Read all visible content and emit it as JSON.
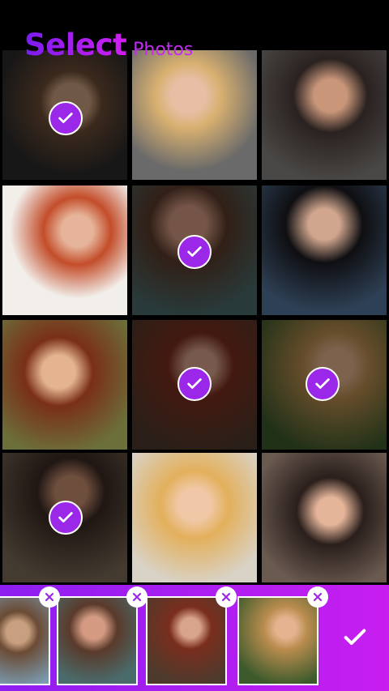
{
  "header": {
    "title_main": "Select",
    "title_sub": "Photos"
  },
  "grid": {
    "photos": [
      {
        "subject": "woman-sunglasses",
        "selected": true
      },
      {
        "subject": "blonde-woman-glasses",
        "selected": false
      },
      {
        "subject": "dark-hair-woman",
        "selected": false
      },
      {
        "subject": "redhead-sweater",
        "selected": false
      },
      {
        "subject": "smiling-woman-flowers",
        "selected": true
      },
      {
        "subject": "asian-woman-dark",
        "selected": false
      },
      {
        "subject": "curly-redhead",
        "selected": false
      },
      {
        "subject": "redhead-brick-wall",
        "selected": true
      },
      {
        "subject": "blonde-leaves",
        "selected": true
      },
      {
        "subject": "woman-empty-shirt",
        "selected": true
      },
      {
        "subject": "laughing-blonde",
        "selected": false
      },
      {
        "subject": "woman-beanie",
        "selected": false
      }
    ]
  },
  "tray": {
    "selected_count": 5,
    "thumbnails": [
      "woman-sunglasses",
      "smiling-woman-flowers",
      "redhead-brick-wall",
      "blonde-leaves"
    ]
  },
  "colors": {
    "accent": "#9b27e8",
    "tray_start": "#8d1ef0",
    "tray_end": "#c81ef0"
  },
  "icons": {
    "check": "check-icon",
    "remove": "close-icon",
    "confirm": "checkmark-icon"
  }
}
